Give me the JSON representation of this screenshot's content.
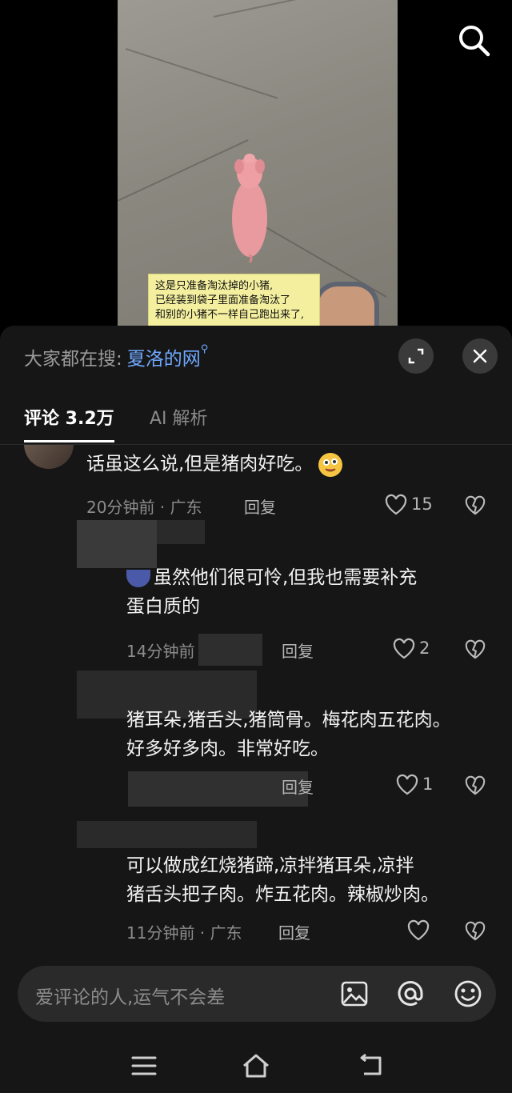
{
  "video": {
    "caption_lines": [
      "这是只准备淘汰掉的小猪,",
      "已经装到袋子里面准备淘汰了",
      "和别的小猪不一样自己跑出来了,"
    ]
  },
  "panel": {
    "hot_search_label": "大家都在搜:",
    "hot_search_term": "夏洛的网",
    "tabs": [
      {
        "label": "评论 3.2万"
      },
      {
        "label": "AI 解析"
      }
    ]
  },
  "comments": [
    {
      "text": "话虽这么说,但是猪肉好吃。",
      "time_location": "20分钟前 · 广东",
      "reply_label": "回复",
      "likes": "15"
    },
    {
      "text_line1": "虽然他们很可怜,但我也需要补充",
      "text_line2": "蛋白质的",
      "time_location": "14分钟前",
      "reply_label": "回复",
      "likes": "2"
    },
    {
      "text_line1": "猪耳朵,猪舌头,猪筒骨。梅花肉五花肉。",
      "text_line2": "好多好多肉。非常好吃。",
      "reply_label": "回复",
      "likes": "1"
    },
    {
      "text_line1": "可以做成红烧猪蹄,凉拌猪耳朵,凉拌",
      "text_line2": "猪舌头把子肉。炸五花肉。辣椒炒肉。",
      "time_location": "11分钟前 · 广东",
      "reply_label": "回复",
      "likes": ""
    }
  ],
  "input": {
    "placeholder": "爱评论的人,运气不会差"
  },
  "icons": [
    "search-icon",
    "fullscreen-icon",
    "close-icon",
    "heart-icon",
    "broken-heart-icon",
    "image-icon",
    "at-icon",
    "emoji-icon",
    "menu-icon",
    "home-icon",
    "back-icon"
  ],
  "colors": {
    "accent_link": "#6fa8ff",
    "panel_bg": "#161616"
  }
}
